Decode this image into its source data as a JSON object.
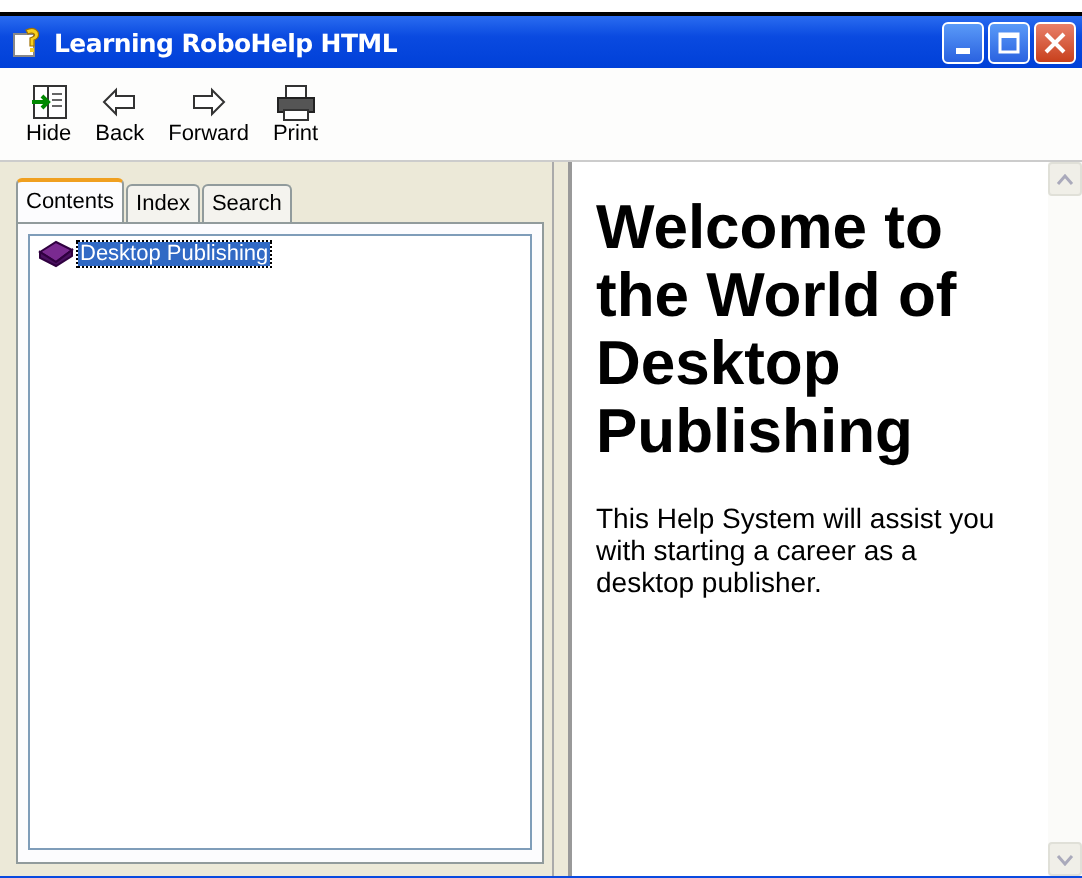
{
  "window": {
    "title": "Learning RoboHelp HTML"
  },
  "toolbar": [
    {
      "label": "Hide",
      "kind": "hide"
    },
    {
      "label": "Back",
      "kind": "back"
    },
    {
      "label": "Forward",
      "kind": "forward"
    },
    {
      "label": "Print",
      "kind": "print"
    }
  ],
  "tabs": [
    {
      "label": "Contents",
      "selected": true
    },
    {
      "label": "Index",
      "selected": false
    },
    {
      "label": "Search",
      "selected": false
    }
  ],
  "contents": [
    {
      "label": "Desktop Publishing",
      "selected": true
    }
  ],
  "topic": {
    "heading": "Welcome to the World of Desktop Publishing",
    "body": "This Help System will assist you with starting a career as a desktop publisher."
  }
}
